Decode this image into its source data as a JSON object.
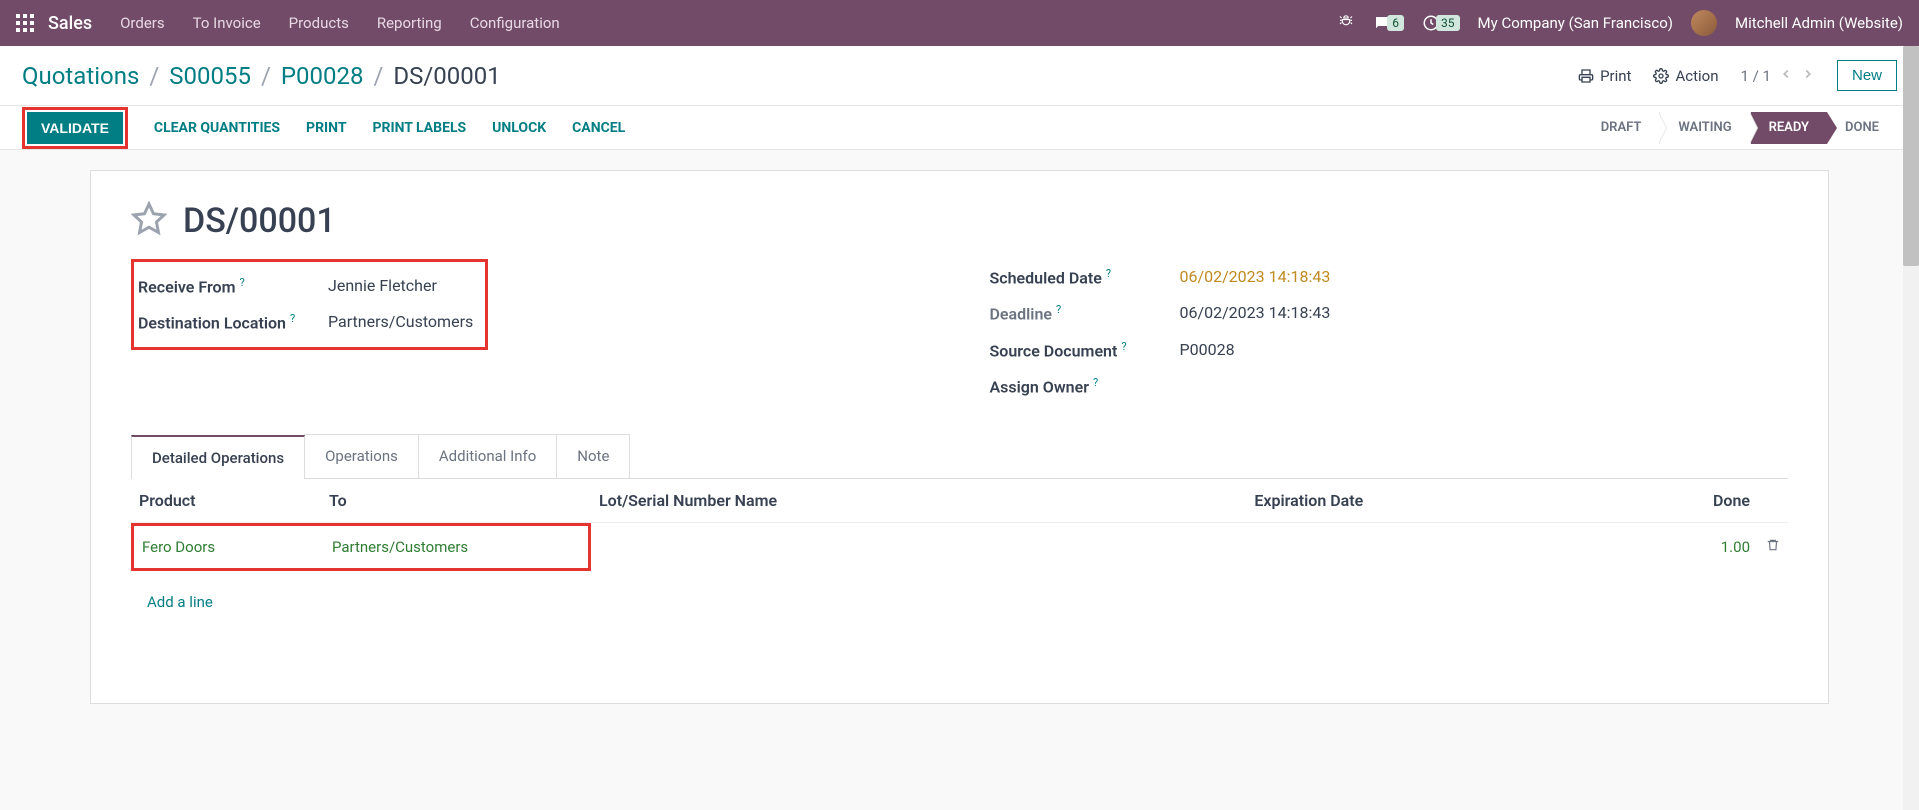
{
  "topbar": {
    "app_name": "Sales",
    "menu": [
      "Orders",
      "To Invoice",
      "Products",
      "Reporting",
      "Configuration"
    ],
    "messages_badge": "6",
    "activities_badge": "35",
    "company": "My Company (San Francisco)",
    "user": "Mitchell Admin (Website)"
  },
  "breadcrumbs": [
    "Quotations",
    "S00055",
    "P00028",
    "DS/00001"
  ],
  "cp": {
    "print": "Print",
    "action": "Action",
    "pager": "1 / 1",
    "new": "New"
  },
  "actions": {
    "validate": "VALIDATE",
    "clear": "CLEAR QUANTITIES",
    "print": "PRINT",
    "print_labels": "PRINT LABELS",
    "unlock": "UNLOCK",
    "cancel": "CANCEL"
  },
  "status": {
    "draft": "DRAFT",
    "waiting": "WAITING",
    "ready": "READY",
    "done": "DONE"
  },
  "record": {
    "title": "DS/00001",
    "receive_from_label": "Receive From",
    "receive_from": "Jennie Fletcher",
    "dest_loc_label": "Destination Location",
    "dest_loc": "Partners/Customers",
    "scheduled_label": "Scheduled Date",
    "scheduled": "06/02/2023 14:18:43",
    "deadline_label": "Deadline",
    "deadline": "06/02/2023 14:18:43",
    "source_label": "Source Document",
    "source": "P00028",
    "owner_label": "Assign Owner"
  },
  "tabs": {
    "detailed": "Detailed Operations",
    "operations": "Operations",
    "additional": "Additional Info",
    "note": "Note"
  },
  "table": {
    "headers": {
      "product": "Product",
      "to": "To",
      "lot": "Lot/Serial Number Name",
      "exp": "Expiration Date",
      "done": "Done"
    },
    "row": {
      "product": "Fero Doors",
      "to": "Partners/Customers",
      "done": "1.00"
    },
    "add_line": "Add a line"
  }
}
